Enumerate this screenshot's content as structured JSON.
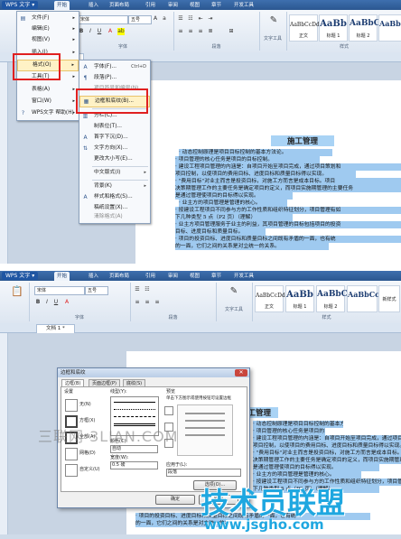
{
  "app": {
    "menu_button": "WPS 文字",
    "tabs": [
      "开始",
      "插入",
      "页面布局",
      "引用",
      "审阅",
      "视图",
      "章节",
      "开发工具"
    ],
    "font_name": "宋体",
    "font_size": "五号",
    "group_labels": [
      "字体",
      "段落",
      "样式"
    ],
    "text_tool": "文字工具",
    "new_style": "新样式",
    "styles": [
      {
        "preview": "AaBbCcDd",
        "name": "正文"
      },
      {
        "preview": "AaBb",
        "name": "标题 1"
      },
      {
        "preview": "AaBbC",
        "name": "标题 2"
      },
      {
        "preview": "AaBbCc",
        "name": "标题 3"
      }
    ],
    "doc_tab": "文档 1 *"
  },
  "wps_menu": {
    "items": [
      {
        "label": "文件(F)",
        "arrow": "▸"
      },
      {
        "label": "编辑(E)",
        "arrow": "▸"
      },
      {
        "label": "视图(V)",
        "arrow": "▸"
      },
      {
        "label": "插入(I)",
        "arrow": "▸"
      },
      {
        "label": "格式(O)",
        "arrow": "▸"
      },
      {
        "label": "工具(T)",
        "arrow": "▸"
      },
      {
        "label": "表格(A)",
        "arrow": "▸"
      },
      {
        "label": "窗口(W)",
        "arrow": "▸"
      },
      {
        "label": "WPS文字 帮助(H)",
        "arrow": "▸"
      }
    ]
  },
  "format_submenu": {
    "items": [
      {
        "label": "字体(F)...",
        "shortcut": "Ctrl+D"
      },
      {
        "label": "段落(P)...",
        "shortcut": ""
      },
      {
        "label": "项目符号和编号(N)...",
        "shortcut": ""
      },
      {
        "label": "边框和底纹(B)...",
        "shortcut": ""
      },
      {
        "label": "分栏(C)...",
        "shortcut": ""
      },
      {
        "label": "制表位(T)...",
        "shortcut": ""
      },
      {
        "label": "首字下沉(D)...",
        "shortcut": ""
      },
      {
        "label": "文字方向(X)...",
        "shortcut": ""
      },
      {
        "label": "更改大小写(E)...",
        "shortcut": ""
      },
      {
        "label": "中文版式(I)",
        "shortcut": "▸"
      },
      {
        "label": "背景(K)",
        "shortcut": "▸"
      },
      {
        "label": "样式和格式(S)...",
        "shortcut": ""
      },
      {
        "label": "稿纸设置(X)...",
        "shortcut": ""
      },
      {
        "label": "清除格式(A)",
        "shortcut": ""
      }
    ]
  },
  "document": {
    "title": "施工管理",
    "lines": [
      "· 动态控制原理是项目目标控制的基本方法论。",
      "· 项目管理的核心任务是项目的目标控制。",
      "· 建设工程项目管理的内涵是：自项目开始至项目完成，通过项目策划和",
      "项目控制，以使项目的费用目标、进度目标和质量目标得以实现。",
      "· \"费用目标\"对业主而言是投资目标，对施工方而言是成本目标。项目",
      "决策期管理工作的主要任务是确定项目的定义，而项目实施期管理的主要任务",
      "是通过管理使项目的目标得以实现。",
      "· 业主方的项目管理是管理的核心。",
      "· 按建设工程项目不同参与方的工作性质和组织特征划分，项目管理有如",
      "下几种类型 5 点（P2 页）（理解）",
      "· 业主方项目管理服务于业主的利益，其项目管理的目标包括项目的投资",
      "目标、进度目标和质量目标。",
      "· 项目的投资目标、进度目标和质量目标之间既有矛盾的一面，也有统",
      "的一面，它们之间的关系是对立统一的关系。"
    ]
  },
  "dialog": {
    "title": "边框和底纹",
    "close": "✕",
    "tabs": [
      "边框(B)",
      "页面边框(P)",
      "底纹(S)"
    ],
    "settings_label": "设置",
    "setting_options": [
      "无(N)",
      "方框(X)",
      "全部(A)",
      "网格(D)",
      "自定义(U)"
    ],
    "line_style_label": "线型(Y):",
    "color_label": "颜色(C):",
    "color_value": "自动",
    "width_label": "宽度(W):",
    "width_value": "0.5 磅",
    "preview_label": "预览",
    "preview_hint": "单击下方图示或使用按钮可设置边框",
    "apply_to_label": "应用于(L):",
    "apply_to_value": "段落",
    "options_button": "选项(O)...",
    "ok_button": "确定",
    "cancel_button": "取消"
  },
  "watermarks": {
    "left": "三联网 3LIAN.COM",
    "logo": "技术员联盟",
    "url": "www.jsgho.com"
  }
}
